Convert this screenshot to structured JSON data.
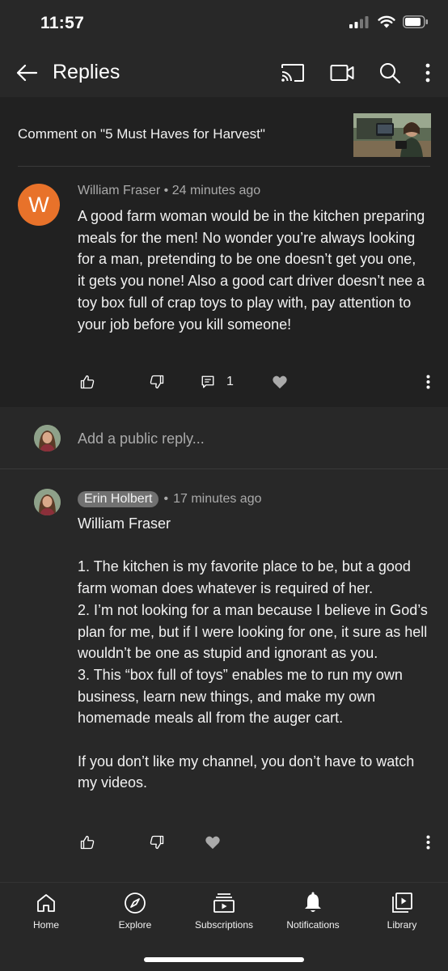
{
  "status_bar": {
    "time": "11:57"
  },
  "app_bar": {
    "title": "Replies"
  },
  "topic": {
    "text": "Comment on \"5 Must Haves for Harvest\""
  },
  "comment": {
    "avatar_letter": "W",
    "author": "William Fraser",
    "separator": "•",
    "time": "24 minutes ago",
    "text": "A good farm woman would be in the kitchen preparing meals for the men! No wonder you’re always looking for a man, pretending to be one doesn’t get you one, it gets you none! Also a good cart driver doesn’t nee a toy box full of crap toys to play with, pay attention to your job before you kill someone!",
    "reply_count": "1",
    "colors": {
      "avatar": "#e8722a"
    }
  },
  "reply_input": {
    "placeholder": "Add a public reply..."
  },
  "reply": {
    "author": "Erin Holbert",
    "separator": "•",
    "time": "17 minutes ago",
    "lines": [
      "William Fraser",
      "",
      "1. The kitchen is my favorite place to be, but a good farm woman does whatever is required of her.",
      "2. I’m not looking for a man because I believe in God’s plan for me, but if I were looking for one, it sure as hell wouldn’t be one as stupid and ignorant as you.",
      "3. This “box full of toys” enables me to run my own business, learn new things, and make my own homemade meals all from the auger cart.",
      "",
      "If you don’t like my channel, you don’t have to watch my videos."
    ]
  },
  "bottom_nav": {
    "items": [
      {
        "label": "Home",
        "icon": "home-icon"
      },
      {
        "label": "Explore",
        "icon": "compass-icon"
      },
      {
        "label": "Subscriptions",
        "icon": "subscriptions-icon"
      },
      {
        "label": "Notifications",
        "icon": "bell-icon"
      },
      {
        "label": "Library",
        "icon": "library-icon"
      }
    ]
  }
}
